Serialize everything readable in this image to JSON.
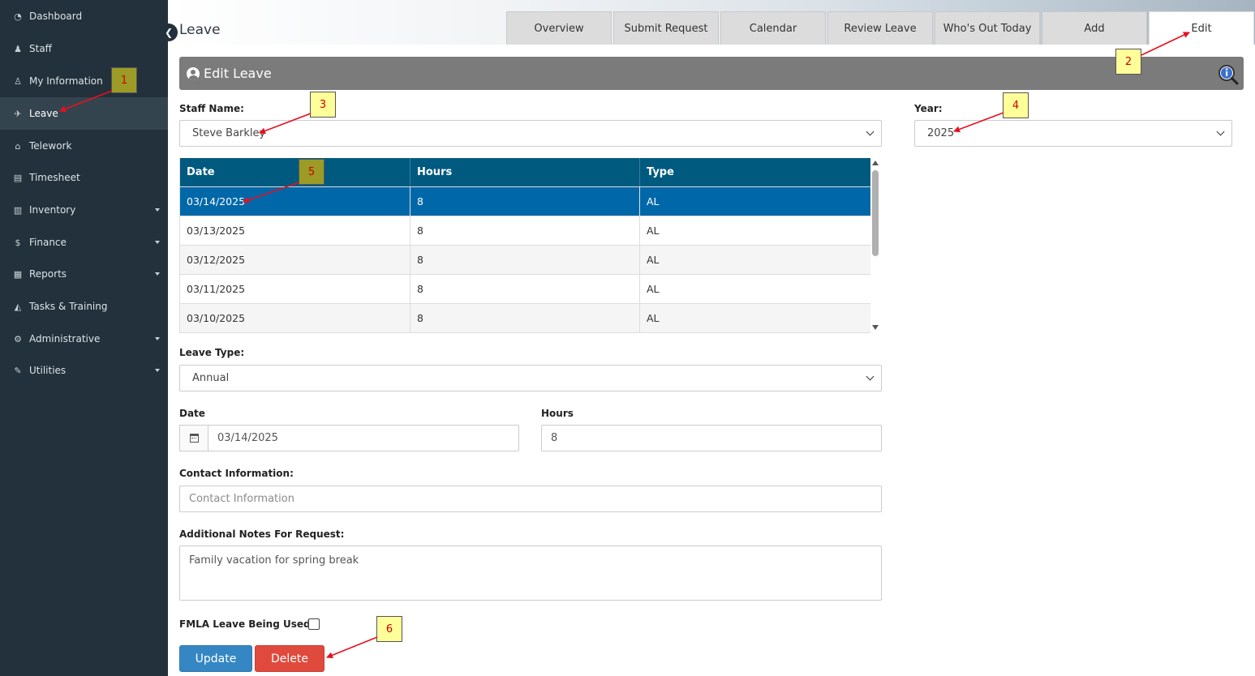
{
  "sidebar": {
    "items": [
      {
        "label": "Dashboard",
        "icon": "dashboard-icon",
        "glyph": "◔"
      },
      {
        "label": "Staff",
        "icon": "users-icon",
        "glyph": "♟"
      },
      {
        "label": "My Information",
        "icon": "user-icon",
        "glyph": "♙"
      },
      {
        "label": "Leave",
        "icon": "plane-icon",
        "glyph": "✈"
      },
      {
        "label": "Telework",
        "icon": "home-icon",
        "glyph": "⌂"
      },
      {
        "label": "Timesheet",
        "icon": "file-icon",
        "glyph": "▤"
      },
      {
        "label": "Inventory",
        "icon": "bar-chart-icon",
        "glyph": "▥"
      },
      {
        "label": "Finance",
        "icon": "dollar-icon",
        "glyph": "$"
      },
      {
        "label": "Reports",
        "icon": "book-icon",
        "glyph": "▦"
      },
      {
        "label": "Tasks & Training",
        "icon": "graduation-cap-icon",
        "glyph": "◭"
      },
      {
        "label": "Administrative",
        "icon": "user-gear-icon",
        "glyph": "⚙"
      },
      {
        "label": "Utilities",
        "icon": "wrench-icon",
        "glyph": "✎"
      }
    ],
    "active_index": 3
  },
  "header": {
    "page_title": "Leave",
    "tabs": [
      {
        "label": "Overview"
      },
      {
        "label": "Submit Request"
      },
      {
        "label": "Calendar"
      },
      {
        "label": "Review Leave"
      },
      {
        "label": "Who's Out Today"
      },
      {
        "label": "Add"
      },
      {
        "label": "Edit"
      }
    ],
    "active_tab": "Edit"
  },
  "panel": {
    "title": "Edit Leave"
  },
  "form": {
    "staff_name_label": "Staff Name:",
    "staff_name_value": "Steve Barkley",
    "year_label": "Year:",
    "year_value": "2025",
    "grid": {
      "headers": [
        "Date",
        "Hours",
        "Type"
      ],
      "rows": [
        {
          "date": "03/14/2025",
          "hours": "8",
          "type": "AL"
        },
        {
          "date": "03/13/2025",
          "hours": "8",
          "type": "AL"
        },
        {
          "date": "03/12/2025",
          "hours": "8",
          "type": "AL"
        },
        {
          "date": "03/11/2025",
          "hours": "8",
          "type": "AL"
        },
        {
          "date": "03/10/2025",
          "hours": "8",
          "type": "AL"
        }
      ],
      "selected_row": 0
    },
    "leave_type_label": "Leave Type:",
    "leave_type_value": "Annual",
    "date_label": "Date",
    "date_value": "03/14/2025",
    "hours_label": "Hours",
    "hours_value": "8",
    "contact_label": "Contact Information:",
    "contact_placeholder": "Contact Information",
    "notes_label": "Additional Notes For Request:",
    "notes_value": "Family vacation for spring break",
    "fmla_label": "FMLA Leave Being Used?",
    "fmla_checked": false,
    "update_label": "Update",
    "delete_label": "Delete"
  },
  "callouts": [
    "1",
    "2",
    "3",
    "4",
    "5",
    "6"
  ],
  "colors": {
    "sidebar_bg": "#22313c",
    "grid_header": "#005a7f",
    "selected_row": "#0068a8",
    "update_button": "#3587c3",
    "delete_button": "#e04a3d",
    "callout_bg": "#ffff99",
    "arrow": "#e8101e"
  }
}
